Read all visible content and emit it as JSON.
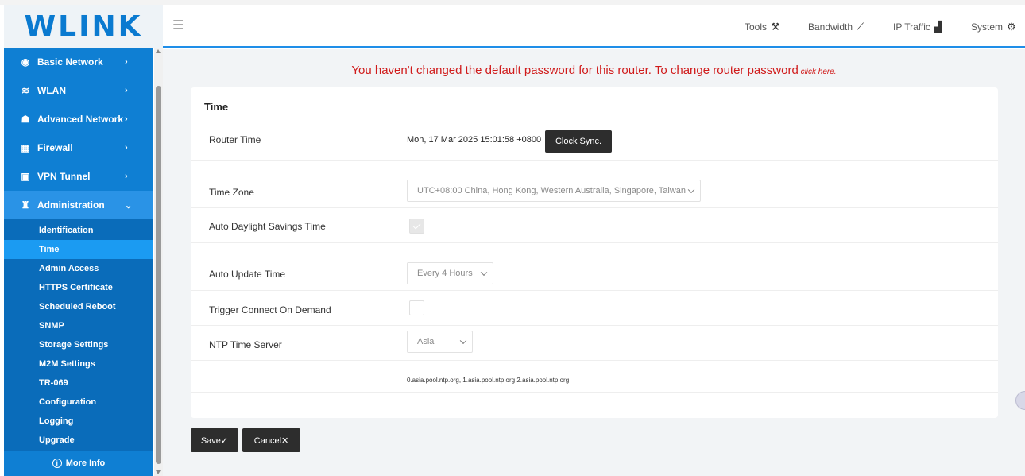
{
  "logo": {
    "text": "WLINK"
  },
  "header": {
    "menu_icon": "hamburger-menu-icon",
    "nav": [
      {
        "label": "Tools",
        "icon": "⚒",
        "icon_name": "tools-icon"
      },
      {
        "label": "Bandwidth",
        "icon": "⟋",
        "icon_name": "line-chart-icon"
      },
      {
        "label": "IP Traffic",
        "icon": "▟",
        "icon_name": "area-chart-icon"
      },
      {
        "label": "System",
        "icon": "⚙",
        "icon_name": "gear-icon"
      }
    ]
  },
  "sidebar": {
    "items": [
      {
        "label": "Basic Network",
        "icon": "◉",
        "chev": "›"
      },
      {
        "label": "WLAN",
        "icon": "≋",
        "chev": "›"
      },
      {
        "label": "Advanced Network",
        "icon": "☗",
        "chev": "›"
      },
      {
        "label": "Firewall",
        "icon": "▦",
        "chev": "›"
      },
      {
        "label": "VPN Tunnel",
        "icon": "▣",
        "chev": "›"
      },
      {
        "label": "Administration",
        "icon": "♜",
        "chev": "⌄"
      }
    ],
    "submenu": [
      "Identification",
      "Time",
      "Admin Access",
      "HTTPS Certificate",
      "Scheduled Reboot",
      "SNMP",
      "Storage Settings",
      "M2M Settings",
      "TR-069",
      "Configuration",
      "Logging",
      "Upgrade"
    ],
    "active_submenu": "Time",
    "more_info": "More Info",
    "more_info_icon": "i"
  },
  "warning": {
    "text": "You haven't changed the default password for this router. To change router password",
    "link": " click here."
  },
  "card": {
    "title": "Time",
    "router_time": {
      "label": "Router Time",
      "value": "Mon, 17 Mar 2025 15:01:58 +0800",
      "sync_button": "Clock Sync."
    },
    "time_zone": {
      "label": "Time Zone",
      "value": "UTC+08:00 China, Hong Kong, Western Australia, Singapore, Taiwan"
    },
    "auto_dst": {
      "label": "Auto Daylight Savings Time",
      "checked": true
    },
    "auto_update": {
      "label": "Auto Update Time",
      "value": "Every 4 Hours"
    },
    "trigger_connect": {
      "label": "Trigger Connect On Demand",
      "checked": false
    },
    "ntp_server": {
      "label": "NTP Time Server",
      "value": "Asia",
      "servers": "0.asia.pool.ntp.org, 1.asia.pool.ntp.org 2.asia.pool.ntp.org"
    }
  },
  "actions": {
    "save": "Save✓",
    "cancel": "Cancel✕"
  },
  "colors": {
    "sidebar": "#0f7fd3",
    "active_submenu": "#1b9bf2",
    "warning": "#d01b1b",
    "accent": "#1f8ee8"
  }
}
